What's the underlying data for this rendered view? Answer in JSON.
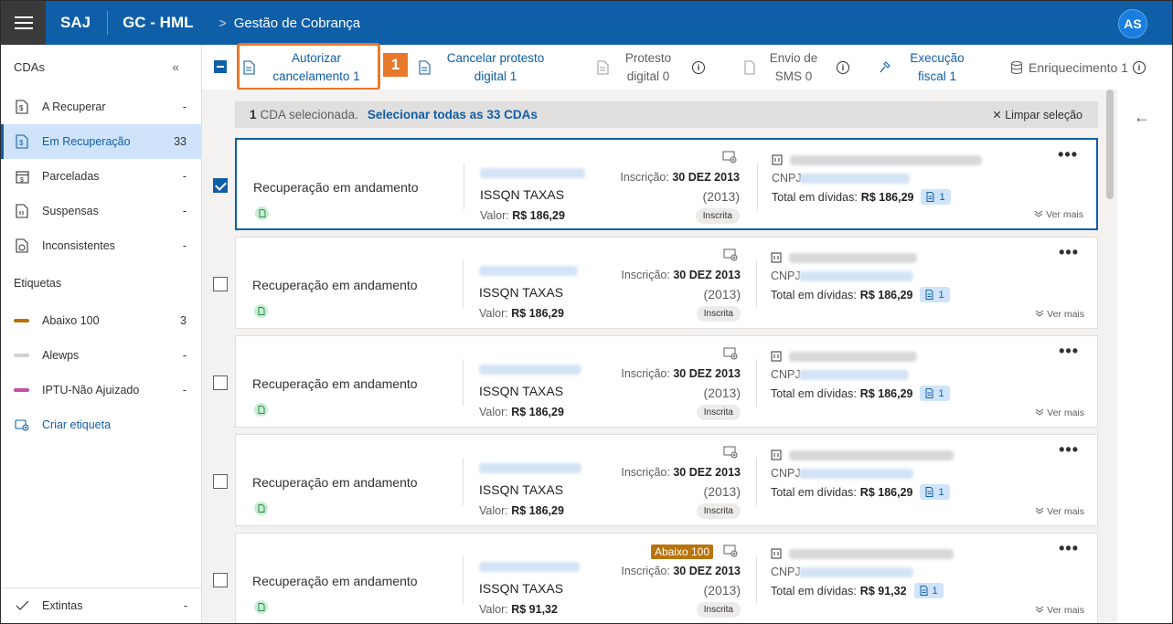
{
  "header": {
    "brand": "SAJ",
    "app_name": "GC - HML",
    "breadcrumb_sep": ">",
    "breadcrumb": "Gestão de Cobrança",
    "avatar": "AS"
  },
  "sidebar": {
    "title": "CDAs",
    "collapse": "«",
    "items": [
      {
        "label": "A Recuperar",
        "count": "-"
      },
      {
        "label": "Em Recuperação",
        "count": "33"
      },
      {
        "label": "Parceladas",
        "count": "-"
      },
      {
        "label": "Suspensas",
        "count": "-"
      },
      {
        "label": "Inconsistentes",
        "count": "-"
      }
    ],
    "tags_title": "Etiquetas",
    "tags": [
      {
        "label": "Abaixo 100",
        "count": "3",
        "color": "#b8740d"
      },
      {
        "label": "Alewps",
        "count": "-",
        "color": "#d2d0ce"
      },
      {
        "label": "IPTU-Não Ajuizado",
        "count": "-",
        "color": "#c44fa4"
      }
    ],
    "create_tag": "Criar etiqueta",
    "bottom_item": {
      "label": "Extintas",
      "count": "-"
    }
  },
  "toolbar": {
    "autorizar_l1": "Autorizar",
    "autorizar_l2": "cancelamento 1",
    "cancelar_l1": "Cancelar protesto",
    "cancelar_l2": "digital 1",
    "protesto_l1": "Protesto",
    "protesto_l2": "digital 0",
    "envio_l1": "Envio de",
    "envio_l2": "SMS 0",
    "execucao_l1": "Execução",
    "execucao_l2": "fiscal 1",
    "enriquecimento": "Enriquecimento 1",
    "step": "1"
  },
  "selection": {
    "count": "1",
    "text": "CDA selecionada.",
    "select_all": "Selecionar todas as 33 CDAs",
    "clear": "✕  Limpar seleção"
  },
  "cards": [
    {
      "status": "Recuperação em andamento",
      "tax": "ISSQN TAXAS",
      "valor_label": "Valor:",
      "valor": "R$ 186,29",
      "insc_label": "Inscrição:",
      "insc_date": "30 DEZ 2013",
      "year": "(2013)",
      "pill": "Inscrita",
      "cnpj": "CNPJ:",
      "total_label": "Total em dívidas:",
      "total": "R$ 186,29",
      "debts": "1",
      "more": "•••",
      "ver_mais": "Ver mais",
      "tag": "",
      "selected": true
    },
    {
      "status": "Recuperação em andamento",
      "tax": "ISSQN TAXAS",
      "valor_label": "Valor:",
      "valor": "R$ 186,29",
      "insc_label": "Inscrição:",
      "insc_date": "30 DEZ 2013",
      "year": "(2013)",
      "pill": "Inscrita",
      "cnpj": "CNPJ:",
      "total_label": "Total em dívidas:",
      "total": "R$ 186,29",
      "debts": "1",
      "more": "•••",
      "ver_mais": "Ver mais",
      "tag": "",
      "selected": false
    },
    {
      "status": "Recuperação em andamento",
      "tax": "ISSQN TAXAS",
      "valor_label": "Valor:",
      "valor": "R$ 186,29",
      "insc_label": "Inscrição:",
      "insc_date": "30 DEZ 2013",
      "year": "(2013)",
      "pill": "Inscrita",
      "cnpj": "CNPJ:",
      "total_label": "Total em dívidas:",
      "total": "R$ 186,29",
      "debts": "1",
      "more": "•••",
      "ver_mais": "Ver mais",
      "tag": "",
      "selected": false
    },
    {
      "status": "Recuperação em andamento",
      "tax": "ISSQN TAXAS",
      "valor_label": "Valor:",
      "valor": "R$ 186,29",
      "insc_label": "Inscrição:",
      "insc_date": "30 DEZ 2013",
      "year": "(2013)",
      "pill": "Inscrita",
      "cnpj": "CNPJ:",
      "total_label": "Total em dívidas:",
      "total": "R$ 186,29",
      "debts": "1",
      "more": "•••",
      "ver_mais": "Ver mais",
      "tag": "",
      "selected": false
    },
    {
      "status": "Recuperação em andamento",
      "tax": "ISSQN TAXAS",
      "valor_label": "Valor:",
      "valor": "R$ 91,32",
      "insc_label": "Inscrição:",
      "insc_date": "30 DEZ 2013",
      "year": "(2013)",
      "pill": "Inscrita",
      "cnpj": "CNPJ:",
      "total_label": "Total em dívidas:",
      "total": "R$ 91,32",
      "debts": "1",
      "more": "•••",
      "ver_mais": "Ver mais",
      "tag": "Abaixo 100",
      "selected": false
    }
  ],
  "right_panel": {
    "back": "←"
  },
  "colors": {
    "primary": "#0f5ea8",
    "accent_highlight": "#e8792b",
    "active_bg": "#cfe4fa"
  }
}
